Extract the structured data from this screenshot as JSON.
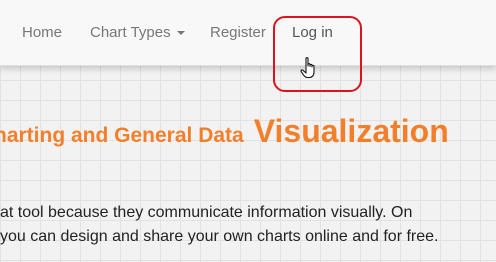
{
  "navbar": {
    "items": [
      {
        "label": "Home"
      },
      {
        "label": "Chart Types"
      },
      {
        "label": "Register"
      },
      {
        "label": "Log in"
      }
    ]
  },
  "headline": {
    "prefix": "harting and General Data",
    "emphasis": "Visualization"
  },
  "body_text": {
    "line1": "at tool because they communicate information visually. On",
    "line2": "you can design and share your own charts online and for free."
  },
  "colors": {
    "accent": "#f47f2b",
    "highlight": "#d9141d",
    "nav_text": "#777777"
  },
  "icons": {
    "cursor": "hand-pointer-icon",
    "dropdown": "caret-down-icon"
  }
}
